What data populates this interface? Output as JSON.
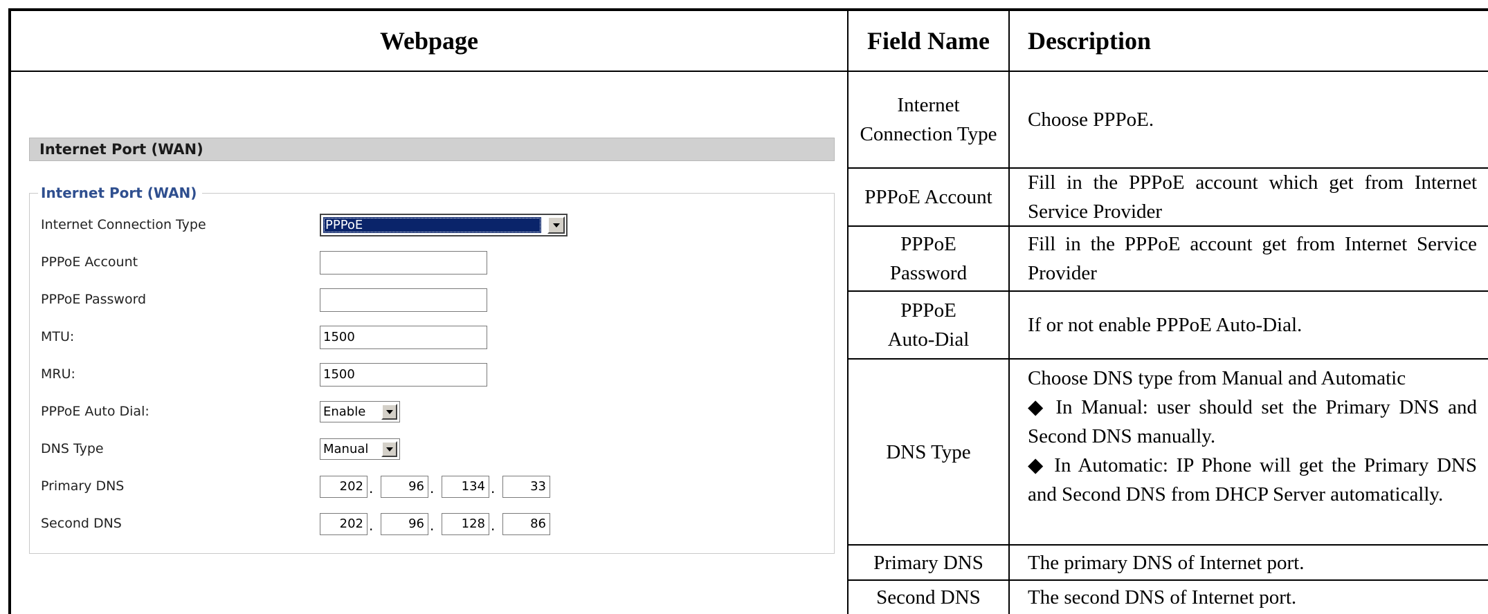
{
  "headers": {
    "webpage": "Webpage",
    "field_name": "Field Name",
    "description": "Description"
  },
  "form": {
    "section_title": "Internet Port (WAN)",
    "fieldset_legend": "Internet Port (WAN)",
    "fields": {
      "connection_type_label": "Internet Connection Type",
      "connection_type_value": "PPPoE",
      "pppoe_account_label": "PPPoE Account",
      "pppoe_account_value": "",
      "pppoe_password_label": "PPPoE Password",
      "pppoe_password_value": "",
      "mtu_label": "MTU:",
      "mtu_value": "1500",
      "mru_label": "MRU:",
      "mru_value": "1500",
      "auto_dial_label": "PPPoE Auto Dial:",
      "auto_dial_value": "Enable",
      "dns_type_label": "DNS Type",
      "dns_type_value": "Manual",
      "primary_dns_label": "Primary DNS",
      "primary_dns": [
        "202",
        "96",
        "134",
        "33"
      ],
      "second_dns_label": "Second DNS",
      "second_dns": [
        "202",
        "96",
        "128",
        "86"
      ]
    }
  },
  "rows": [
    {
      "field": "Internet Connection Type",
      "description": "Choose PPPoE."
    },
    {
      "field": "PPPoE Account",
      "description": "Fill in the PPPoE account which get from Internet Service Provider"
    },
    {
      "field": "PPPoE Password",
      "description": "Fill in the PPPoE account get from Internet Service Provider"
    },
    {
      "field": "PPPoE Auto-Dial",
      "description": "If or not enable PPPoE Auto-Dial."
    },
    {
      "field": "DNS Type",
      "description_lines": [
        "Choose DNS type from Manual and Automatic",
        "◆ In Manual: user should set the Primary DNS and Second DNS manually.",
        "◆ In Automatic: IP Phone will get the Primary DNS and Second DNS from DHCP Server automatically."
      ]
    },
    {
      "field": "Primary DNS",
      "description": "The primary DNS of Internet port."
    },
    {
      "field": "Second DNS",
      "description": "The second DNS of Internet port."
    }
  ]
}
